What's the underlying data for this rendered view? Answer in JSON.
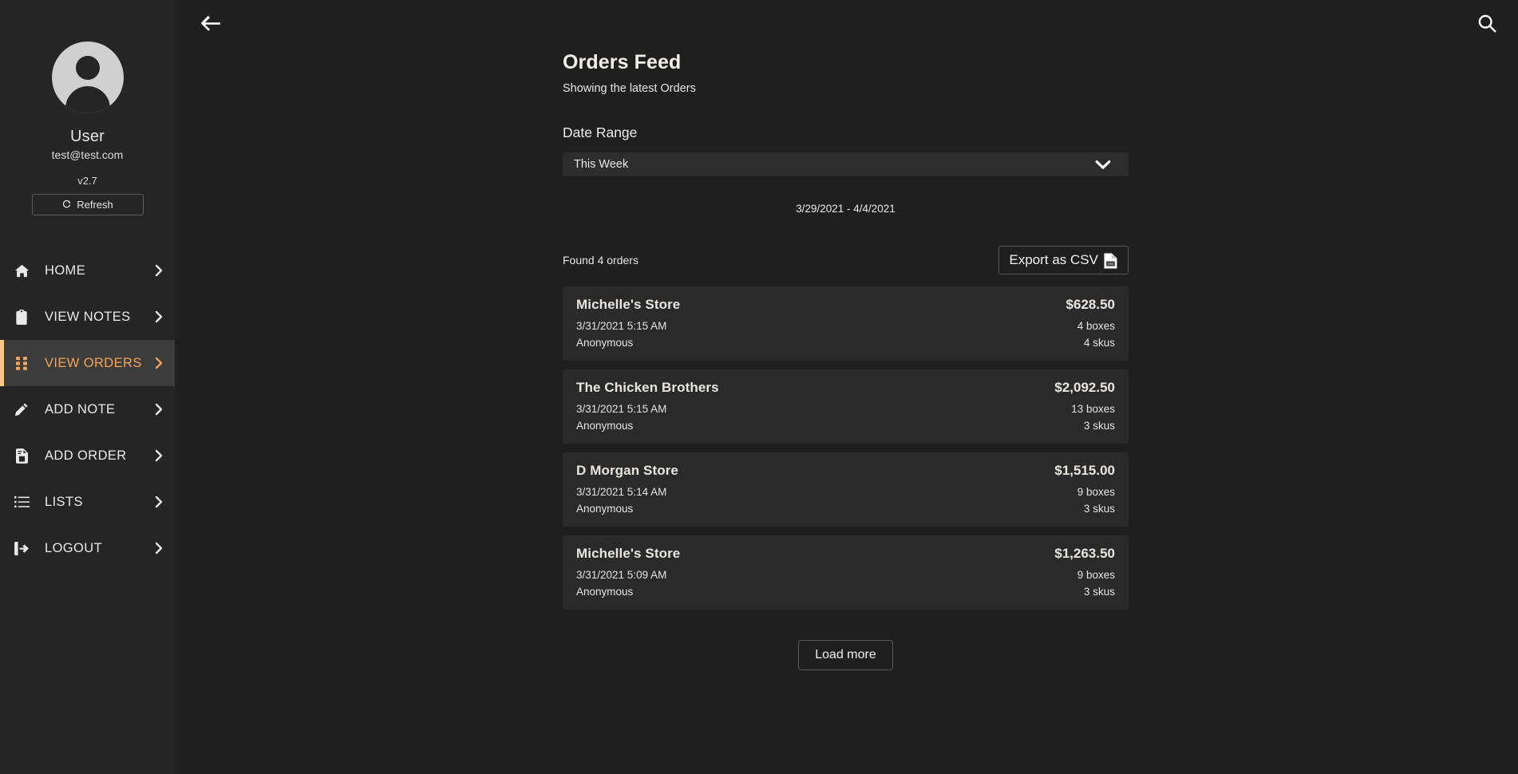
{
  "sidebar": {
    "avatar_alt": "User avatar",
    "user_name": "User",
    "user_email": "test@test.com",
    "version": "v2.7",
    "refresh_label": "Refresh",
    "items": [
      {
        "label": "HOME",
        "icon": "home-icon",
        "active": false
      },
      {
        "label": "VIEW NOTES",
        "icon": "clipboard-icon",
        "active": false
      },
      {
        "label": "VIEW ORDERS",
        "icon": "grid-icon",
        "active": true
      },
      {
        "label": "ADD NOTE",
        "icon": "pencil-icon",
        "active": false
      },
      {
        "label": "ADD ORDER",
        "icon": "invoice-icon",
        "active": false
      },
      {
        "label": "LISTS",
        "icon": "list-icon",
        "active": false
      },
      {
        "label": "LOGOUT",
        "icon": "signout-icon",
        "active": false
      }
    ]
  },
  "topbar": {
    "back_icon": "arrow-left-icon",
    "search_icon": "search-icon"
  },
  "main": {
    "title": "Orders Feed",
    "subtitle": "Showing the latest Orders",
    "date_range_label": "Date Range",
    "date_range_selected": "This Week",
    "date_range_options": [
      "This Week"
    ],
    "date_range_text": "3/29/2021 - 4/4/2021",
    "found_text": "Found 4 orders",
    "export_label": "Export as CSV",
    "export_icon": "csv-file-icon",
    "load_more_label": "Load more",
    "orders": [
      {
        "store": "Michelle's Store",
        "total": "$628.50",
        "timestamp": "3/31/2021 5:15 AM",
        "boxes": "4 boxes",
        "customer": "Anonymous",
        "skus": "4 skus"
      },
      {
        "store": "The Chicken Brothers",
        "total": "$2,092.50",
        "timestamp": "3/31/2021 5:15 AM",
        "boxes": "13 boxes",
        "customer": "Anonymous",
        "skus": "3 skus"
      },
      {
        "store": "D Morgan Store",
        "total": "$1,515.00",
        "timestamp": "3/31/2021 5:14 AM",
        "boxes": "9 boxes",
        "customer": "Anonymous",
        "skus": "3 skus"
      },
      {
        "store": "Michelle's Store",
        "total": "$1,263.50",
        "timestamp": "3/31/2021 5:09 AM",
        "boxes": "9 boxes",
        "customer": "Anonymous",
        "skus": "3 skus"
      }
    ]
  },
  "colors": {
    "accent": "#f0a45a",
    "accent_bar": "#f8c98a",
    "sidebar_bg": "#252525",
    "active_bg": "#3c3c3c",
    "page_bg": "#1f1f1f",
    "card_bg": "#2a2a2a",
    "select_bg": "#2d2d2d"
  }
}
